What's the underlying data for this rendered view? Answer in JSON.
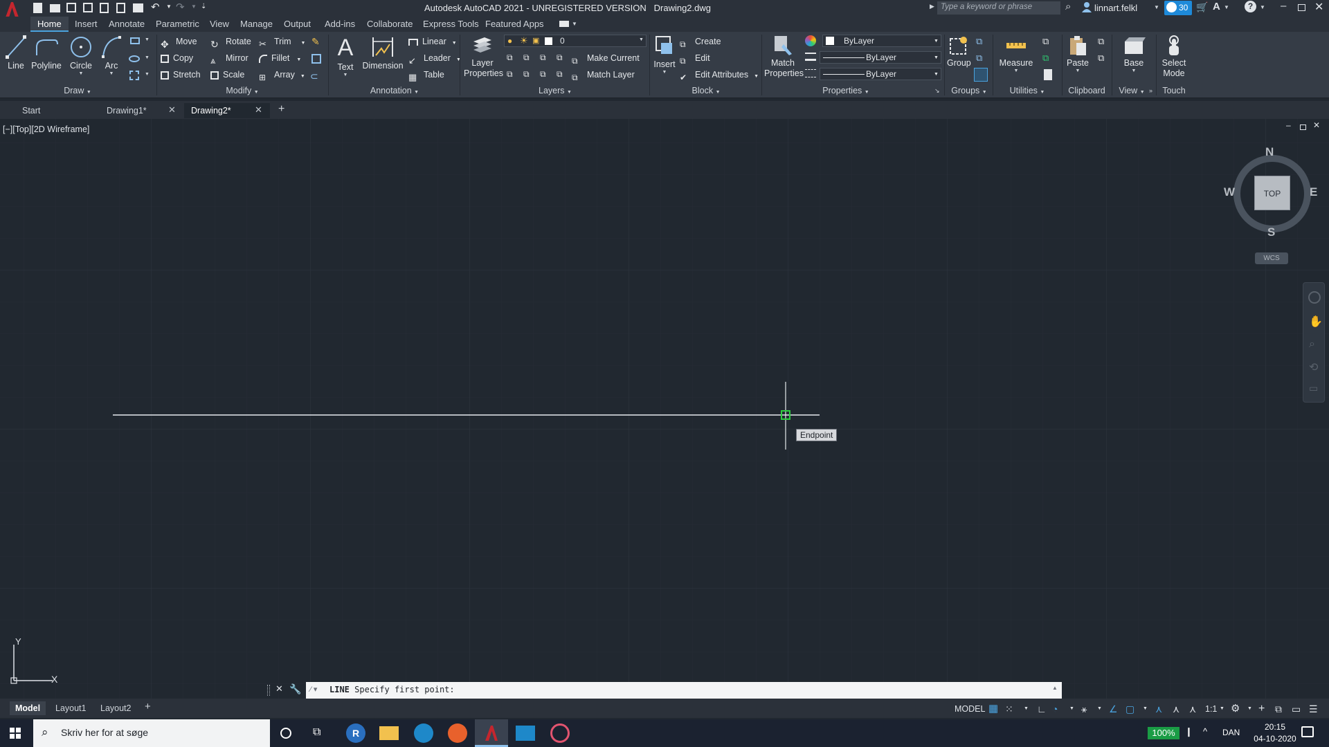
{
  "titlebar": {
    "title": "Autodesk AutoCAD 2021 - UNREGISTERED VERSION",
    "filename": "Drawing2.dwg",
    "search_placeholder": "Type a keyword or phrase",
    "user": "linnart.felkl",
    "badge_count": "30"
  },
  "ribbon_tabs": [
    "Home",
    "Insert",
    "Annotate",
    "Parametric",
    "View",
    "Manage",
    "Output",
    "Add-ins",
    "Collaborate",
    "Express Tools",
    "Featured Apps"
  ],
  "draw": {
    "panel_label": "Draw",
    "line": "Line",
    "polyline": "Polyline",
    "circle": "Circle",
    "arc": "Arc"
  },
  "modify": {
    "panel_label": "Modify",
    "move": "Move",
    "rotate": "Rotate",
    "trim": "Trim",
    "copy": "Copy",
    "mirror": "Mirror",
    "fillet": "Fillet",
    "stretch": "Stretch",
    "scale": "Scale",
    "array": "Array"
  },
  "annotation": {
    "panel_label": "Annotation",
    "text": "Text",
    "dimension": "Dimension",
    "linear": "Linear",
    "leader": "Leader",
    "table": "Table"
  },
  "layers": {
    "panel_label": "Layers",
    "layer_properties": "Layer Properties",
    "current_layer": "0",
    "make_current": "Make Current",
    "match_layer": "Match Layer"
  },
  "block": {
    "panel_label": "Block",
    "insert": "Insert",
    "create": "Create",
    "edit": "Edit",
    "edit_attributes": "Edit Attributes"
  },
  "properties": {
    "panel_label": "Properties",
    "match_properties": "Match Properties",
    "color": "ByLayer",
    "linetype": "ByLayer",
    "lineweight": "ByLayer"
  },
  "groups": {
    "panel_label": "Groups",
    "group": "Group"
  },
  "utilities": {
    "panel_label": "Utilities",
    "measure": "Measure"
  },
  "clipboard": {
    "panel_label": "Clipboard",
    "paste": "Paste"
  },
  "view": {
    "panel_label": "View",
    "base": "Base"
  },
  "touch": {
    "panel_label": "Touch",
    "select_mode": "Select Mode"
  },
  "doc_tabs": [
    "Start",
    "Drawing1*",
    "Drawing2*"
  ],
  "viewport": {
    "label": "[−][Top][2D Wireframe]",
    "tooltip": "Endpoint",
    "compass": {
      "n": "N",
      "s": "S",
      "e": "E",
      "w": "W",
      "top": "TOP",
      "wcs": "WCS"
    },
    "ucs_x": "X",
    "ucs_y": "Y"
  },
  "command": {
    "name": "LINE",
    "prompt": "Specify first point:"
  },
  "layout_tabs": [
    "Model",
    "Layout1",
    "Layout2"
  ],
  "status": {
    "model": "MODEL",
    "scale": "1:1"
  },
  "taskbar": {
    "search_placeholder": "Skriv her for at søge",
    "battery": "100%",
    "language": "DAN",
    "time": "20:15",
    "date": "04-10-2020"
  }
}
